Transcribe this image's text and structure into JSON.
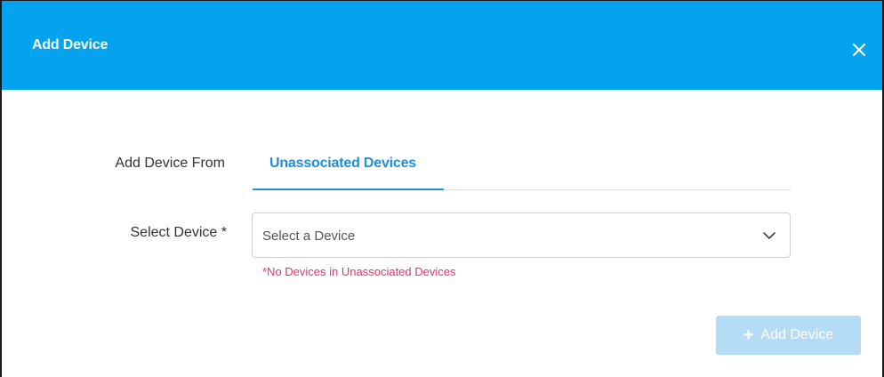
{
  "dialog": {
    "title": "Add Device",
    "close_icon": "close-icon"
  },
  "form": {
    "add_from_label": "Add Device From",
    "tabs": [
      {
        "label": "Unassociated Devices",
        "active": true
      }
    ],
    "select_label": "Select Device *",
    "select_placeholder": "Select a Device",
    "select_icon": "chevron-down-icon",
    "error_message": "*No Devices in Unassociated Devices"
  },
  "actions": {
    "add_button_label": "Add Device",
    "add_button_icon": "plus-icon",
    "add_button_disabled": true
  },
  "colors": {
    "header_bg": "#03a3f0",
    "accent": "#1e8fe0",
    "error": "#e8336a",
    "disabled_button": "#b5dcf7"
  }
}
